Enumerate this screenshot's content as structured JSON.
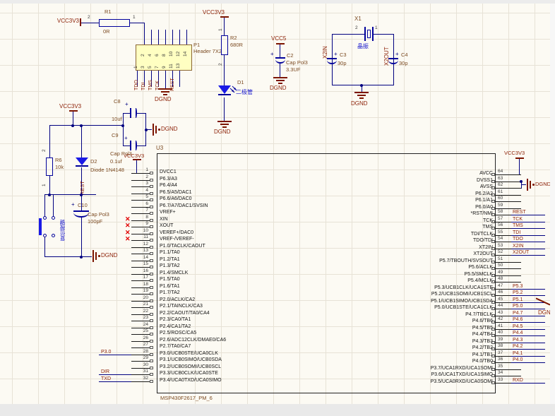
{
  "colors": {
    "wire": "#000080",
    "symbol": "#00009B",
    "designator": "#7B4A21",
    "net_label": "#8B1E04",
    "power": "#7C1500",
    "comment_cn": "#1414CC",
    "header_fill": "#FFFFC2",
    "no_erc_x": "#E00000",
    "sheet_bg": "#FCFAF3",
    "grid": "#E7E2D6"
  },
  "power": {
    "vcc3v3": "VCC3V3",
    "vcc5": "VCC5",
    "dgnd": "DGND"
  },
  "nets": {
    "rest": "REST",
    "x2in": "X2IN",
    "x2out": "X2OUT",
    "p3_0": "P3.0",
    "dir": "DIR",
    "txd": "TXD",
    "rxd": "RXD"
  },
  "r1": {
    "designator": "R1",
    "value": "0R",
    "pin_left": "2",
    "pin_right": "1"
  },
  "p1": {
    "designator": "P1",
    "comment": "Header 7X2",
    "top_pins": [
      {
        "n": "2"
      },
      {
        "n": "4"
      },
      {
        "n": "6"
      },
      {
        "n": "8"
      },
      {
        "n": "10"
      },
      {
        "n": "12"
      },
      {
        "n": "14"
      }
    ],
    "bottom_pins": [
      {
        "n": "1"
      },
      {
        "n": "3"
      },
      {
        "n": "5"
      },
      {
        "n": "7"
      },
      {
        "n": "9"
      },
      {
        "n": "11"
      },
      {
        "n": "13"
      }
    ],
    "signals": [
      {
        "s": "TDO"
      },
      {
        "s": "TDI"
      },
      {
        "s": "TMS"
      },
      {
        "s": "TCK"
      }
    ],
    "reset_net": "REST"
  },
  "r2": {
    "designator": "R2",
    "value": "680R",
    "pin_top": "1",
    "pin_bottom": "2"
  },
  "d1": {
    "designator": "D1",
    "comment": "二极管"
  },
  "c2": {
    "designator": "C2",
    "lib": "Cap Pol3",
    "value": "3.3UF",
    "plus": "+"
  },
  "x1": {
    "designator": "X1",
    "comment": "晶振",
    "pin_left": "2",
    "pin_right": "1"
  },
  "c3": {
    "designator": "C3",
    "value": "30p",
    "plus": "+"
  },
  "c4": {
    "designator": "C4",
    "value": "30p",
    "plus": "+"
  },
  "c8": {
    "designator": "C8",
    "value": "10uf",
    "plus": "+"
  },
  "c9": {
    "designator": "C9",
    "lib": "Cap Pol3",
    "value": "0.1uf",
    "plus": "+"
  },
  "r6": {
    "designator": "R6",
    "value": "10k",
    "pin_top": "2",
    "pin_bottom": "1"
  },
  "d2": {
    "designator": "D2",
    "comment": "Diode 1N4148"
  },
  "c10": {
    "designator": "C10",
    "lib": "Cap Pol3",
    "value": "100pF",
    "plus": "+"
  },
  "sw1": {
    "comment": "复位按键"
  },
  "u3": {
    "designator": "U3",
    "part": "MSP430F2617_PM_6",
    "left_pins": [
      {
        "num": "1",
        "name": "DVCC1",
        "net": "",
        "noerc": ""
      },
      {
        "num": "2",
        "name": "P6.3/A3",
        "net": "",
        "noerc": ""
      },
      {
        "num": "3",
        "name": "P6.4/A4",
        "net": "",
        "noerc": ""
      },
      {
        "num": "4",
        "name": "P6.5/A5/DAC1",
        "net": "",
        "noerc": ""
      },
      {
        "num": "5",
        "name": "P6.6/A6/DAC0",
        "net": "",
        "noerc": ""
      },
      {
        "num": "6",
        "name": "P6.7/A7/DAC1/SVSIN",
        "net": "",
        "noerc": ""
      },
      {
        "num": "7",
        "name": "VREF+",
        "net": "",
        "noerc": ""
      },
      {
        "num": "8",
        "name": "XIN",
        "net": "",
        "noerc": "✕"
      },
      {
        "num": "9",
        "name": "XOUT",
        "net": "",
        "noerc": "✕"
      },
      {
        "num": "10",
        "name": "VEREF+/DAC0",
        "net": "",
        "noerc": "✕"
      },
      {
        "num": "11",
        "name": "VREF-/VEREF-",
        "net": "",
        "noerc": "✕"
      },
      {
        "num": "12",
        "name": "P1.0/TACLK/CAOUT",
        "net": "",
        "noerc": ""
      },
      {
        "num": "13",
        "name": "P1.1/TA0",
        "net": "",
        "noerc": ""
      },
      {
        "num": "14",
        "name": "P1.2/TA1",
        "net": "",
        "noerc": ""
      },
      {
        "num": "15",
        "name": "P1.3/TA2",
        "net": "",
        "noerc": ""
      },
      {
        "num": "16",
        "name": "P1.4/SMCLK",
        "net": "",
        "noerc": ""
      },
      {
        "num": "17",
        "name": "P1.5/TA0",
        "net": "",
        "noerc": ""
      },
      {
        "num": "18",
        "name": "P1.6/TA1",
        "net": "",
        "noerc": ""
      },
      {
        "num": "19",
        "name": "P1.7/TA2",
        "net": "",
        "noerc": ""
      },
      {
        "num": "20",
        "name": "P2.0/ACLK/CA2",
        "net": "",
        "noerc": ""
      },
      {
        "num": "21",
        "name": "P2.1/TAINCLK/CA3",
        "net": "",
        "noerc": ""
      },
      {
        "num": "22",
        "name": "P2.2/CAOUT/TA0/CA4",
        "net": "",
        "noerc": ""
      },
      {
        "num": "23",
        "name": "P2.3/CA0/TA1",
        "net": "",
        "noerc": ""
      },
      {
        "num": "24",
        "name": "P2.4/CA1/TA2",
        "net": "",
        "noerc": ""
      },
      {
        "num": "25",
        "name": "P2.5/ROSC/CA5",
        "net": "",
        "noerc": ""
      },
      {
        "num": "26",
        "name": "P2.6/ADC12CLK/DMAE0/CA6",
        "net": "",
        "noerc": ""
      },
      {
        "num": "27",
        "name": "P2.7/TA0/CA7",
        "net": "",
        "noerc": ""
      },
      {
        "num": "28",
        "name": "P3.0/UCB0STE/UCA0CLK",
        "net": "P3.0",
        "noerc": ""
      },
      {
        "num": "29",
        "name": "P3.1/UCB0SIMO/UCB0SDA",
        "net": "",
        "noerc": ""
      },
      {
        "num": "30",
        "name": "P3.2/UCB0SOMI/UCB0SCL",
        "net": "",
        "noerc": ""
      },
      {
        "num": "31",
        "name": "P3.3/UCB0CLK/UCA0STE",
        "net": "DIR",
        "noerc": ""
      },
      {
        "num": "32",
        "name": "P3.4/UCA0TXD/UCA0SIMO",
        "net": "TXD",
        "noerc": ""
      }
    ],
    "right_pins": [
      {
        "num": "64",
        "name": "AVCC",
        "net": ""
      },
      {
        "num": "63",
        "name": "DVSS1",
        "net": ""
      },
      {
        "num": "62",
        "name": "AVSS",
        "net": ""
      },
      {
        "num": "61",
        "name": "P6.2/A2",
        "net": ""
      },
      {
        "num": "60",
        "name": "P6.1/A1",
        "net": ""
      },
      {
        "num": "59",
        "name": "P6.0/A0",
        "net": ""
      },
      {
        "num": "58",
        "name": "*RST/NMI",
        "net": "REST"
      },
      {
        "num": "57",
        "name": "TCK",
        "net": "TCK"
      },
      {
        "num": "56",
        "name": "TMS",
        "net": "TMS"
      },
      {
        "num": "55",
        "name": "TDI/TCLK",
        "net": "TDI"
      },
      {
        "num": "54",
        "name": "TDO/TDI",
        "net": "TDO"
      },
      {
        "num": "53",
        "name": "XT2IN",
        "net": "X2IN"
      },
      {
        "num": "52",
        "name": "XT2OUT",
        "net": "X2OUT"
      },
      {
        "num": "51",
        "name": "P5.7/TBOUTH/SVSOUT",
        "net": ""
      },
      {
        "num": "50",
        "name": "P5.6/ACLK",
        "net": ""
      },
      {
        "num": "49",
        "name": "P5.5/SMCLK",
        "net": ""
      },
      {
        "num": "48",
        "name": "P5.4/MCLK",
        "net": ""
      },
      {
        "num": "47",
        "name": "P5.3/UCB1CLK/UCA1STE",
        "net": "P5.3"
      },
      {
        "num": "46",
        "name": "P5.2/UCB1SOMI/UCB1SCL",
        "net": "P5.2"
      },
      {
        "num": "45",
        "name": "P5.1/UCB1SIMO/UCB1SDA",
        "net": "P5.1"
      },
      {
        "num": "44",
        "name": "P5.0/UCB1STE/UCA1CLK",
        "net": "P5.0"
      },
      {
        "num": "43",
        "name": "P4.7/TBCLK",
        "net": "P4.7"
      },
      {
        "num": "42",
        "name": "P4.6/TB6",
        "net": "P4.6"
      },
      {
        "num": "41",
        "name": "P4.5/TB5",
        "net": "P4.5"
      },
      {
        "num": "40",
        "name": "P4.4/TB4",
        "net": "P4.4"
      },
      {
        "num": "39",
        "name": "P4.3/TB3",
        "net": "P4.3"
      },
      {
        "num": "38",
        "name": "P4.2/TB2",
        "net": "P4.2"
      },
      {
        "num": "37",
        "name": "P4.1/TB1",
        "net": "P4.1"
      },
      {
        "num": "36",
        "name": "P4.0/TB0",
        "net": "P4.0"
      },
      {
        "num": "35",
        "name": "P3.7/UCA1RXD/UCA1SOMI",
        "net": ""
      },
      {
        "num": "34",
        "name": "P3.6/UCA1TXD/UCA1SIMO",
        "net": ""
      },
      {
        "num": "33",
        "name": "P3.5/UCA0RXD/UCA0SOMI",
        "net": "RXD"
      }
    ]
  }
}
